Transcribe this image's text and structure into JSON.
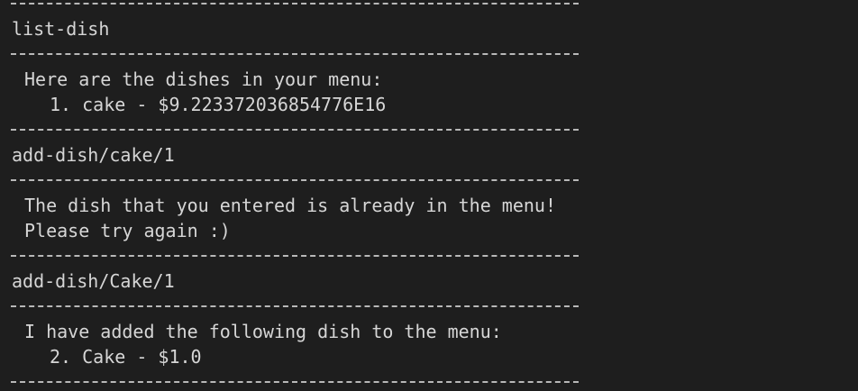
{
  "terminal": {
    "lines": [
      "list-dish",
      "Here are the dishes in your menu:",
      "1. cake - $9.223372036854776E16",
      "add-dish/cake/1",
      "The dish that you entered is already in the menu!",
      "Please try again :)",
      "add-dish/Cake/1",
      "I have added the following dish to the menu:",
      "2. Cake - $1.0"
    ]
  },
  "colors": {
    "background": "#1e1e1e",
    "text": "#d6d6d6",
    "separator": "#b8b8b8"
  }
}
